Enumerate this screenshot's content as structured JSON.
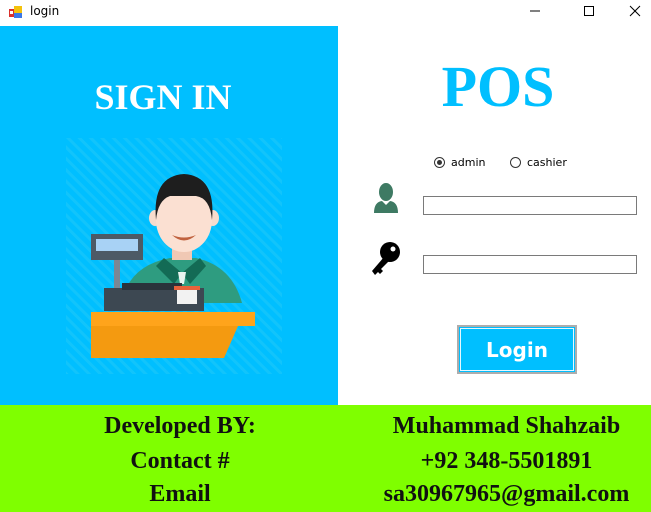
{
  "window": {
    "title": "login",
    "app_icon": "windows-forms-app-icon",
    "controls": [
      "minimize",
      "maximize",
      "close"
    ]
  },
  "left_panel": {
    "heading": "SIGN IN",
    "illustration": "cashier-at-pos-counter",
    "background_color": "#00bfff"
  },
  "login_form": {
    "app_title": "POS",
    "roles": [
      {
        "label": "admin",
        "checked": true
      },
      {
        "label": "cashier",
        "checked": false
      }
    ],
    "username": {
      "icon": "user-icon",
      "value": "",
      "placeholder": ""
    },
    "password": {
      "icon": "key-icon",
      "value": "",
      "placeholder": ""
    },
    "login_button_label": "Login",
    "accent_color": "#00bfff"
  },
  "footer": {
    "background_color": "#7fff00",
    "labels": [
      "Developed BY:",
      "Contact #",
      "Email"
    ],
    "values": [
      "Muhammad Shahzaib",
      "+92 348-5501891",
      "sa30967965@gmail.com"
    ]
  }
}
